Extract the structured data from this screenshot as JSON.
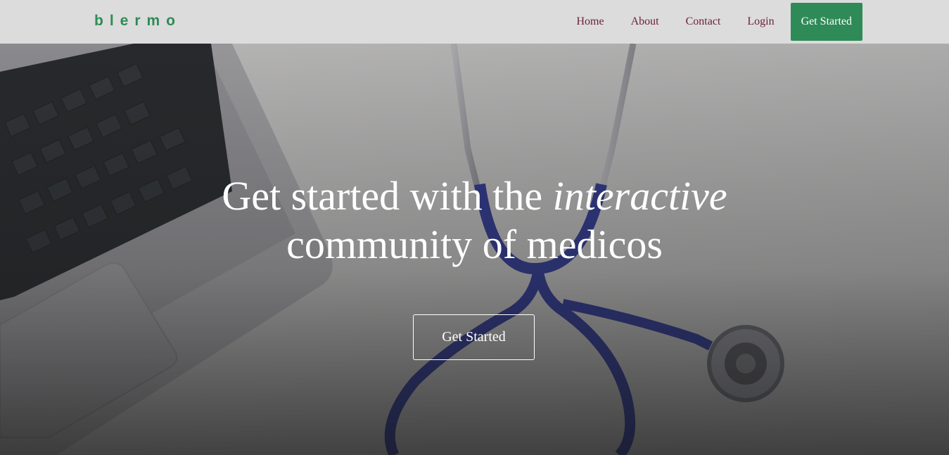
{
  "nav": {
    "brand": "blermo",
    "links": [
      "Home",
      "About",
      "Contact",
      "Login"
    ],
    "cta_label": "Get Started"
  },
  "hero": {
    "headline_before": "Get started with the ",
    "headline_emphasis": "interactive",
    "headline_after": "community of medicos",
    "cta_label": "Get Started",
    "image_icon": "laptop-stethoscope-photo"
  },
  "colors": {
    "navbar_bg": "#dcdcdc",
    "brand": "#2e8b57",
    "nav_link": "#6b1f3a",
    "cta_bg": "#2e8b57",
    "hero_text": "#ffffff"
  }
}
